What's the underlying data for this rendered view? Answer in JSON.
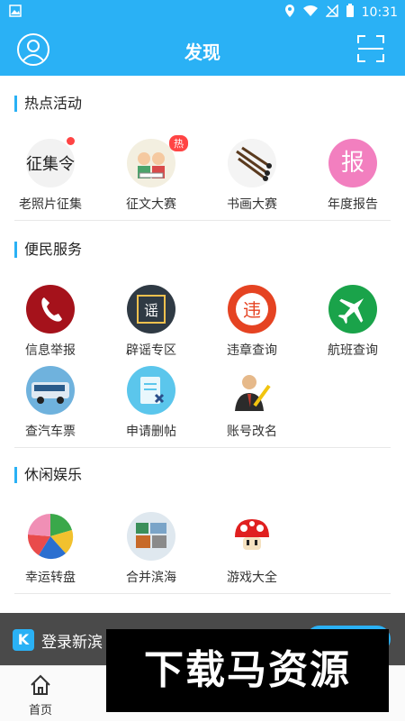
{
  "status": {
    "time": "10:31"
  },
  "header": {
    "title": "发现"
  },
  "sections": [
    {
      "title": "热点活动",
      "items": [
        {
          "label": "老照片征集",
          "icon": "calligraphy-photo-icon"
        },
        {
          "label": "征文大赛",
          "icon": "kids-reading-icon",
          "badge": "热"
        },
        {
          "label": "书画大赛",
          "icon": "brushes-icon"
        },
        {
          "label": "年度报告",
          "icon": "report-icon",
          "glyph": "报"
        }
      ]
    },
    {
      "title": "便民服务",
      "items": [
        {
          "label": "信息举报",
          "icon": "phone-icon"
        },
        {
          "label": "辟谣专区",
          "icon": "rumor-icon",
          "glyph": "谣"
        },
        {
          "label": "违章查询",
          "icon": "violation-icon",
          "glyph": "违"
        },
        {
          "label": "航班查询",
          "icon": "airplane-icon"
        },
        {
          "label": "查汽车票",
          "icon": "bus-icon"
        },
        {
          "label": "申请删帖",
          "icon": "delete-post-icon"
        },
        {
          "label": "账号改名",
          "icon": "rename-icon"
        }
      ]
    },
    {
      "title": "休闲娱乐",
      "items": [
        {
          "label": "幸运转盘",
          "icon": "wheel-icon"
        },
        {
          "label": "合并滨海",
          "icon": "puzzle-icon"
        },
        {
          "label": "游戏大全",
          "icon": "mushroom-icon"
        }
      ]
    }
  ],
  "login_bar": {
    "label": "登录新滨"
  },
  "tabs": [
    {
      "label": "首页",
      "icon": "home-icon"
    },
    {
      "label": "",
      "icon": "tab2-icon"
    },
    {
      "label": "",
      "icon": "tab3-icon"
    },
    {
      "label": "",
      "icon": "tab4-icon"
    },
    {
      "label": "",
      "icon": "tab5-icon"
    }
  ],
  "watermark": "下载马资源",
  "colors": {
    "accent": "#2ab1f5"
  }
}
